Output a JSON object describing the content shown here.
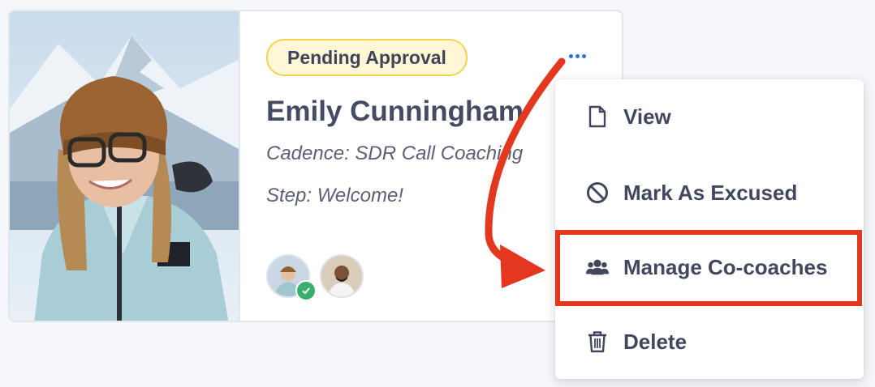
{
  "card": {
    "status_badge": "Pending Approval",
    "name": "Emily Cunningham",
    "cadence": "Cadence: SDR Call Coaching",
    "step": "Step: Welcome!",
    "avatars": [
      "coachee-avatar",
      "coach-avatar"
    ]
  },
  "menu": {
    "items": [
      {
        "label": "View",
        "icon": "document-icon"
      },
      {
        "label": "Mark As Excused",
        "icon": "ban-icon"
      },
      {
        "label": "Manage Co-coaches",
        "icon": "users-icon"
      },
      {
        "label": "Delete",
        "icon": "trash-icon"
      }
    ]
  },
  "colors": {
    "highlight": "#e4371f",
    "badge_border": "#f3d34f",
    "badge_bg": "#fff7d6",
    "more_dots": "#2f6fe0",
    "check": "#3aaf6b"
  }
}
